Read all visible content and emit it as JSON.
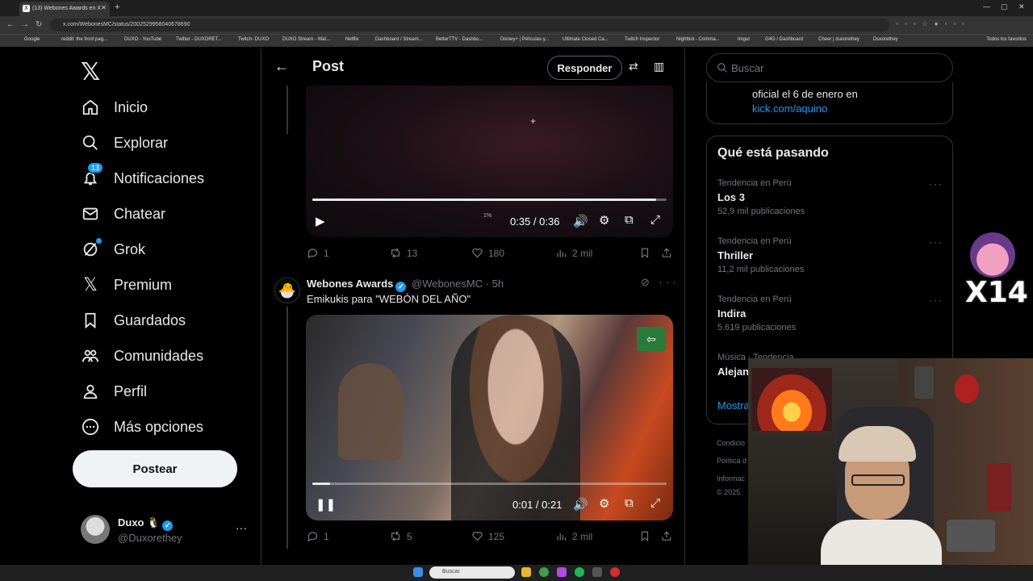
{
  "browser": {
    "tab_title": "(13) Webones Awards en X",
    "url": "x.com/WebonesMC/status/2002529958040678690",
    "bookmarks": [
      "Google",
      "reddit: the front pag...",
      "DUXO - YouTube",
      "Twitter - DUXORET...",
      "Twitch- DUXO",
      "DUXO Stream - Wat...",
      "Netflix",
      "Dashboard / Stream...",
      "BetterTTV - Dashbo...",
      "Disney+ | Películas y...",
      "Ultimate Closed Ca...",
      "Twitch Inspector",
      "Nightbot - Comma...",
      "Imgur",
      "G4G / Dashboard",
      "Cheer | duxorethey",
      "Duxorethey"
    ],
    "all_favorites": "Todos los favoritos"
  },
  "nav": {
    "items": [
      {
        "label": "Inicio",
        "icon": "home-icon"
      },
      {
        "label": "Explorar",
        "icon": "search-icon"
      },
      {
        "label": "Notificaciones",
        "icon": "bell-icon",
        "badge": "13"
      },
      {
        "label": "Chatear",
        "icon": "mail-icon"
      },
      {
        "label": "Grok",
        "icon": "grok-icon"
      },
      {
        "label": "Premium",
        "icon": "x-icon"
      },
      {
        "label": "Guardados",
        "icon": "bookmark-icon"
      },
      {
        "label": "Comunidades",
        "icon": "people-icon"
      },
      {
        "label": "Perfil",
        "icon": "person-icon"
      },
      {
        "label": "Más opciones",
        "icon": "more-icon"
      }
    ],
    "post_button": "Postear",
    "profile": {
      "name": "Duxo 🐧",
      "handle": "@Duxorethey"
    }
  },
  "header": {
    "title": "Post",
    "reply_button": "Responder"
  },
  "video1": {
    "time": "0:35 / 0:36",
    "progress": 0.97,
    "overlay_text": "1%"
  },
  "tweet1_actions": {
    "replies": "1",
    "retweets": "13",
    "likes": "180",
    "views": "2 mil"
  },
  "tweet2": {
    "name": "Webones Awards",
    "handle": "@WebonesMC",
    "time": "· 5h",
    "text": "Emikukis para \"WEBÓN DEL AÑO\"",
    "avatar": "🐣"
  },
  "video2": {
    "time": "0:01 / 0:21",
    "progress": 0.05
  },
  "tweet2_actions": {
    "replies": "1",
    "retweets": "5",
    "likes": "125",
    "views": "2 mil"
  },
  "right": {
    "search_placeholder": "Buscar",
    "card_text": "oficial el 6 de enero en",
    "card_link": "kick.com/aquino",
    "trends_title": "Qué está pasando",
    "trends": [
      {
        "context": "Tendencia en Perú",
        "name": "Los 3",
        "count": "52,9 mil publicaciones"
      },
      {
        "context": "Tendencia en Perú",
        "name": "Thriller",
        "count": "11,2 mil publicaciones"
      },
      {
        "context": "Tendencia en Perú",
        "name": "Indira",
        "count": "5.619 publicaciones"
      },
      {
        "context": "Música · Tendencia",
        "name": "Alejan",
        "count": ""
      }
    ],
    "show_more": "Mostra",
    "footer": [
      "Condicio",
      "Política d",
      "Informac",
      "© 2025"
    ]
  },
  "emote_text": "X14",
  "taskbar": {
    "search": "Buscar"
  }
}
